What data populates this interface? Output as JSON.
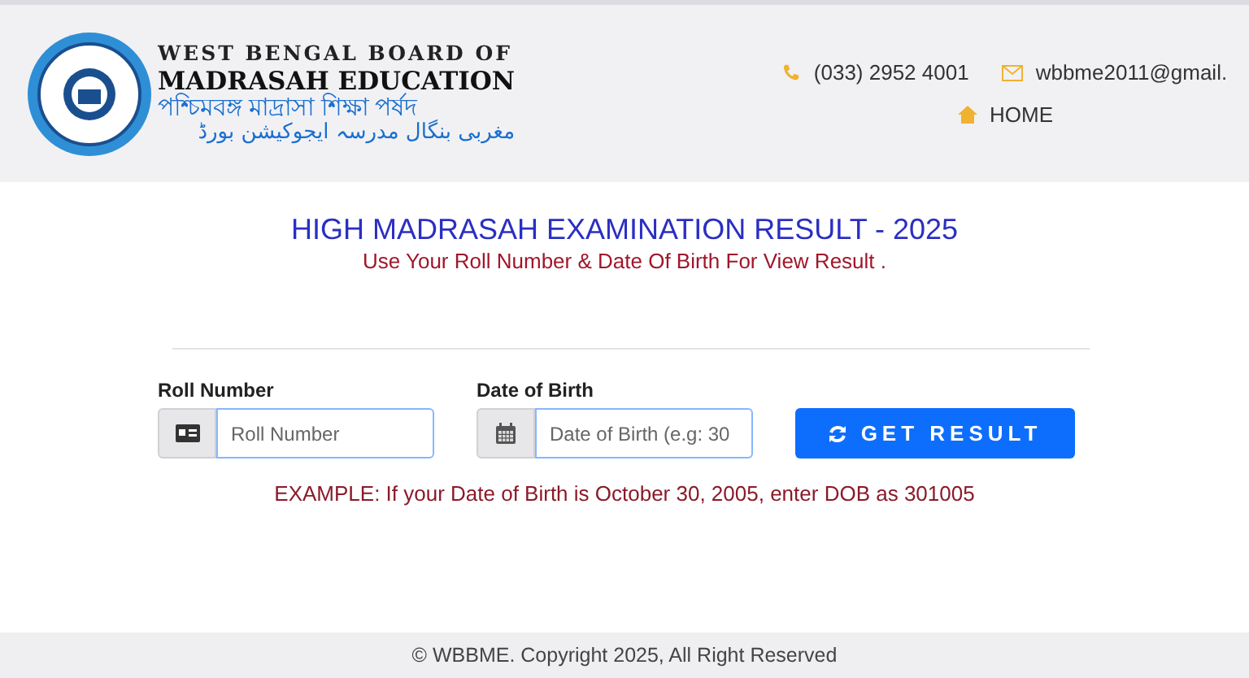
{
  "header": {
    "logo_lines": [
      "WEST BENGAL BOARD OF",
      "MADRASAH EDUCATION",
      "পশ্চিমবঙ্গ মাদ্রাসা শিক্ষা পর্ষদ",
      "مغربی بنگال مدرسہ ایجوکیشن بورڈ"
    ],
    "phone": "(033) 2952 4001",
    "email": "wbbme2011@gmail.",
    "nav": [
      {
        "label": "HOME"
      }
    ]
  },
  "main": {
    "title": "HIGH MADRASAH EXAMINATION RESULT - 2025",
    "subtitle": "Use Your Roll Number & Date Of Birth For View Result .",
    "fields": [
      {
        "kind": "id",
        "label": "Roll Number",
        "placeholder": "Roll Number"
      },
      {
        "kind": "date",
        "label": "Date of Birth",
        "placeholder": "Date of Birth (e.g: 30"
      }
    ],
    "button": "GET RESULT",
    "example": "EXAMPLE: If your Date of Birth is October 30, 2005, enter DOB as 301005"
  },
  "footer": "© WBBME. Copyright 2025, All Right Reserved"
}
